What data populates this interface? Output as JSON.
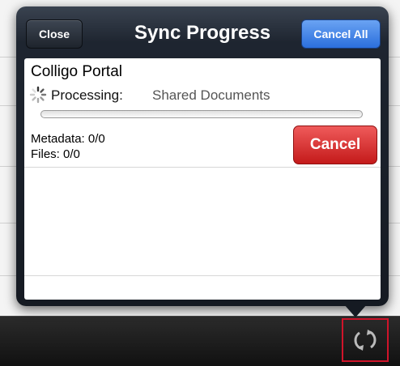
{
  "popover": {
    "close_label": "Close",
    "title": "Sync Progress",
    "cancel_all_label": "Cancel All"
  },
  "item": {
    "name": "Colligo Portal",
    "processing_label": "Processing:",
    "processing_target": "Shared Documents",
    "progress": 0,
    "metadata": "Metadata: 0/0",
    "files": "Files: 0/0",
    "cancel_label": "Cancel"
  },
  "icons": {
    "spinner": "activity-spinner-icon",
    "sync": "sync-icon"
  }
}
